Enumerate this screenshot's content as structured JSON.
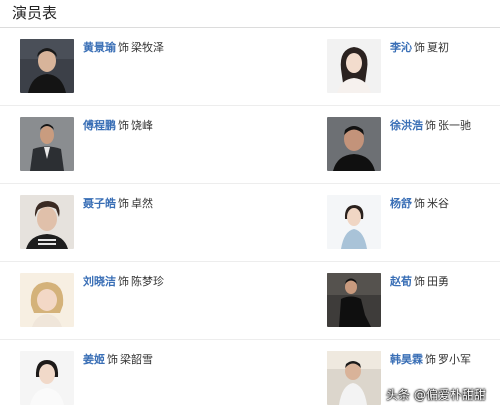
{
  "section": {
    "title": "演员表"
  },
  "role_word": "饰",
  "cast": [
    {
      "actor": "黄景瑜",
      "character": "梁牧泽",
      "side": "left"
    },
    {
      "actor": "李沁",
      "character": "夏初",
      "side": "right"
    },
    {
      "actor": "傅程鹏",
      "character": "饶峰",
      "side": "left"
    },
    {
      "actor": "徐洪浩",
      "character": "张一驰",
      "side": "right"
    },
    {
      "actor": "聂子皓",
      "character": "卓然",
      "side": "left"
    },
    {
      "actor": "杨舒",
      "character": "米谷",
      "side": "right"
    },
    {
      "actor": "刘晓洁",
      "character": "陈梦珍",
      "side": "left"
    },
    {
      "actor": "赵荀",
      "character": "田勇",
      "side": "right"
    },
    {
      "actor": "姜姬",
      "character": "梁韶雪",
      "side": "left"
    },
    {
      "actor": "韩昊霖",
      "character": "罗小军",
      "side": "right"
    }
  ],
  "watermark": "头条 @偏爱朴甜甜",
  "colors": {
    "actor_link": "#3a6fb6",
    "row_divider": "#ededed",
    "title_rule": "#dcdcdc"
  }
}
